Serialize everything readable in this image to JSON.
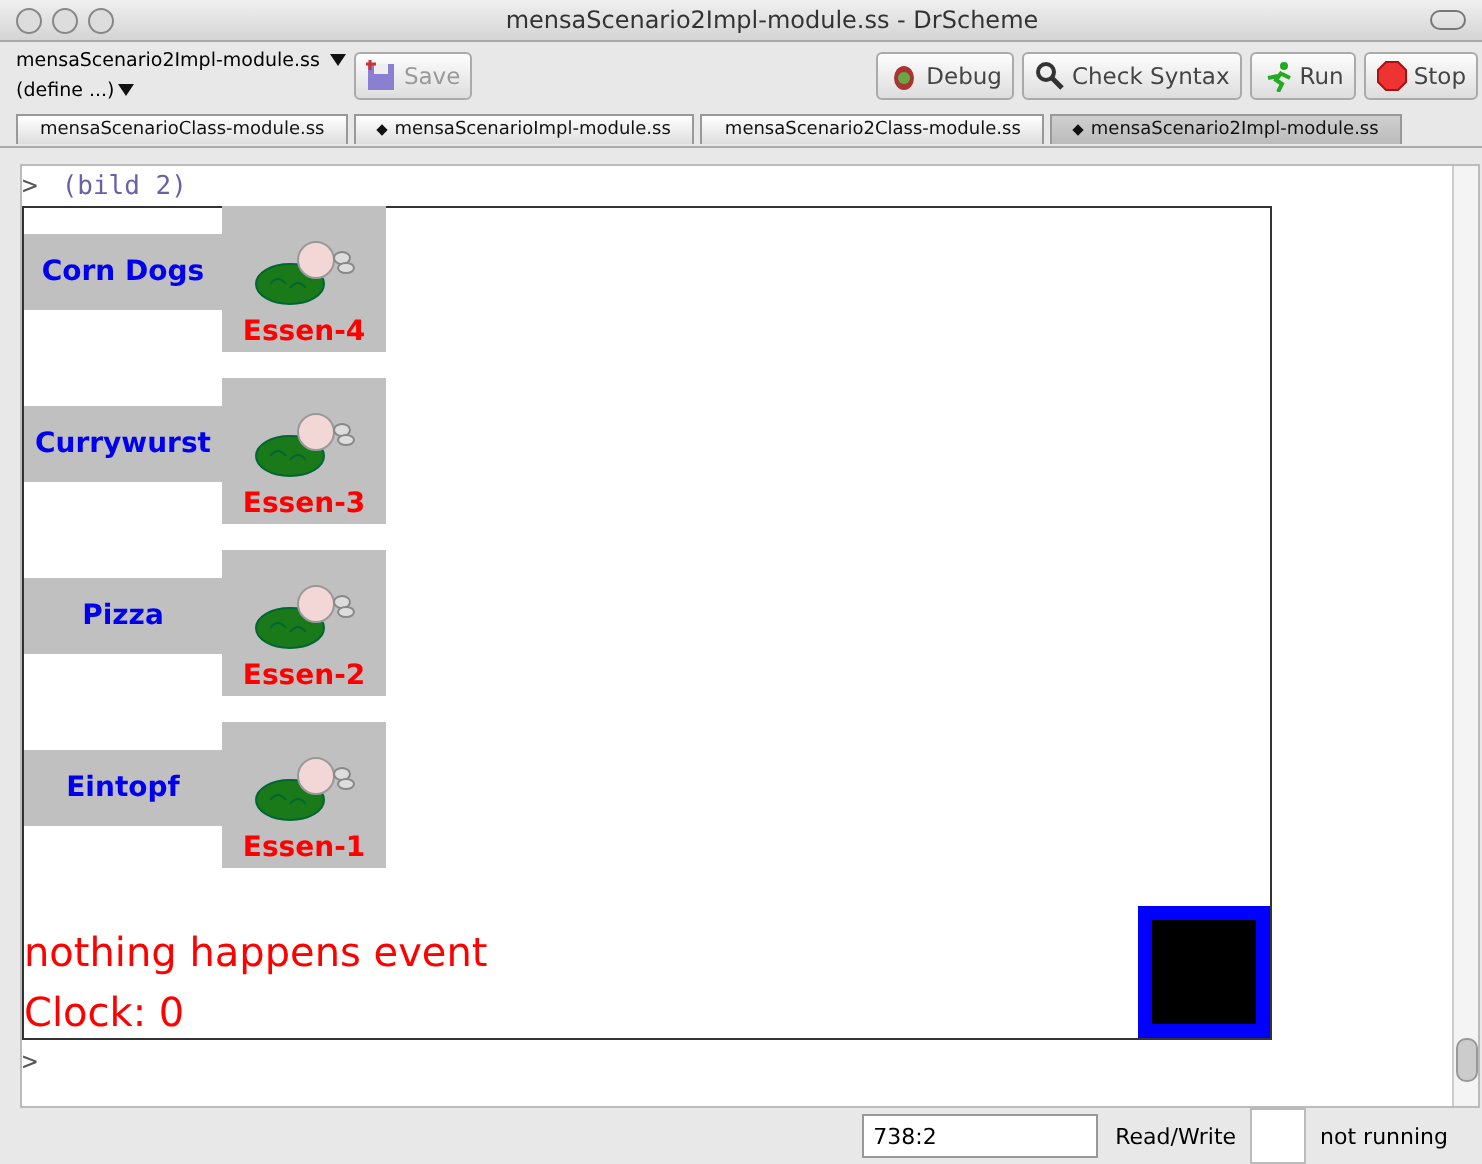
{
  "window": {
    "title": "mensaScenario2Impl-module.ss - DrScheme"
  },
  "toolbar": {
    "file_menu": "mensaScenario2Impl-module.ss",
    "define_menu": "(define ...)",
    "buttons": [
      {
        "kind": "save",
        "label": "Save",
        "disabled": true
      },
      {
        "kind": "debug",
        "label": "Debug",
        "disabled": false
      },
      {
        "kind": "check",
        "label": "Check Syntax",
        "disabled": false
      },
      {
        "kind": "run",
        "label": "Run",
        "disabled": false
      },
      {
        "kind": "stop",
        "label": "Stop",
        "disabled": false
      }
    ]
  },
  "tabs": [
    {
      "label": "mensaScenarioClass-module.ss",
      "modified": false,
      "selected": false
    },
    {
      "label": "mensaScenarioImpl-module.ss",
      "modified": true,
      "selected": false
    },
    {
      "label": "mensaScenario2Class-module.ss",
      "modified": false,
      "selected": false
    },
    {
      "label": "mensaScenario2Impl-module.ss",
      "modified": true,
      "selected": true
    }
  ],
  "repl": {
    "prompt": ">",
    "expression": "(bild 2)",
    "next_prompt": ">",
    "canvas": {
      "items": [
        {
          "name": "Corn Dogs",
          "tag": "Essen-4"
        },
        {
          "name": "Currywurst",
          "tag": "Essen-3"
        },
        {
          "name": "Pizza",
          "tag": "Essen-2"
        },
        {
          "name": "Eintopf",
          "tag": "Essen-1"
        }
      ],
      "event": "nothing happens event",
      "clock": "Clock: 0"
    }
  },
  "status_bar": {
    "position": "738:2",
    "mode": "Read/Write",
    "state": "not running"
  }
}
